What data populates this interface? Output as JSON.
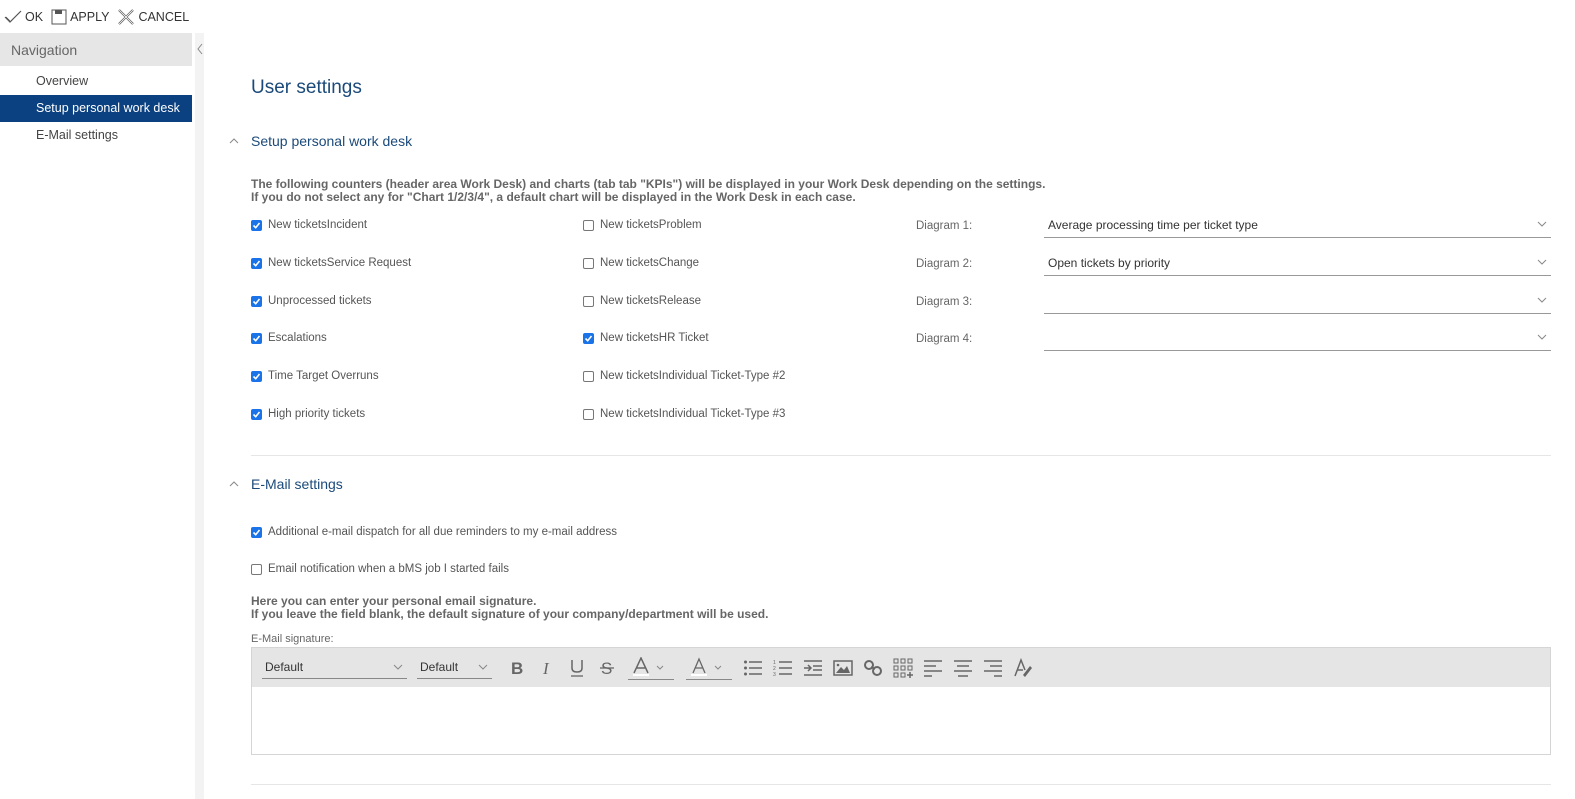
{
  "toolbar": {
    "ok_label": "OK",
    "apply_label": "APPLY",
    "cancel_label": "CANCEL"
  },
  "sidebar": {
    "header": "Navigation",
    "items": [
      {
        "label": "Overview",
        "active": false
      },
      {
        "label": "Setup personal work desk",
        "active": true
      },
      {
        "label": "E-Mail settings",
        "active": false
      }
    ]
  },
  "page": {
    "title": "User settings"
  },
  "workdesk": {
    "section_title": "Setup personal work desk",
    "info_line1": "The following counters (header area Work Desk) and charts (tab tab \"KPIs\") will be displayed in your Work Desk depending on the settings.",
    "info_line2": "If you do not select any for \"Chart 1/2/3/4\", a default chart will be displayed in the Work Desk in each case.",
    "col1": [
      {
        "label": "New ticketsIncident",
        "checked": true
      },
      {
        "label": "New ticketsService Request",
        "checked": true
      },
      {
        "label": "Unprocessed tickets",
        "checked": true
      },
      {
        "label": "Escalations",
        "checked": true
      },
      {
        "label": "Time Target Overruns",
        "checked": true
      },
      {
        "label": "High priority tickets",
        "checked": true
      }
    ],
    "col2": [
      {
        "label": "New ticketsProblem",
        "checked": false
      },
      {
        "label": "New ticketsChange",
        "checked": false
      },
      {
        "label": "New ticketsRelease",
        "checked": false
      },
      {
        "label": "New ticketsHR Ticket",
        "checked": true
      },
      {
        "label": "New ticketsIndividual Ticket-Type #2",
        "checked": false
      },
      {
        "label": "New ticketsIndividual Ticket-Type #3",
        "checked": false
      }
    ],
    "diagrams": [
      {
        "label": "Diagram 1:",
        "value": "Average processing time per ticket type"
      },
      {
        "label": "Diagram 2:",
        "value": "Open tickets by priority"
      },
      {
        "label": "Diagram 3:",
        "value": ""
      },
      {
        "label": "Diagram 4:",
        "value": ""
      }
    ]
  },
  "email": {
    "section_title": "E-Mail settings",
    "options": [
      {
        "label": "Additional e-mail dispatch for all due reminders to my e-mail address",
        "checked": true
      },
      {
        "label": "Email notification when a bMS job I started fails",
        "checked": false
      }
    ],
    "info_line1": "Here you can enter your personal email signature.",
    "info_line2": "If you leave the field blank, the default signature of your company/department will be used.",
    "signature_label": "E-Mail signature:",
    "editor": {
      "font_family": "Default",
      "font_size": "Default",
      "content": ""
    }
  },
  "colors": {
    "accent": "#0b4180",
    "checkbox": "#1a73e8",
    "heading": "#1b4a7a"
  }
}
